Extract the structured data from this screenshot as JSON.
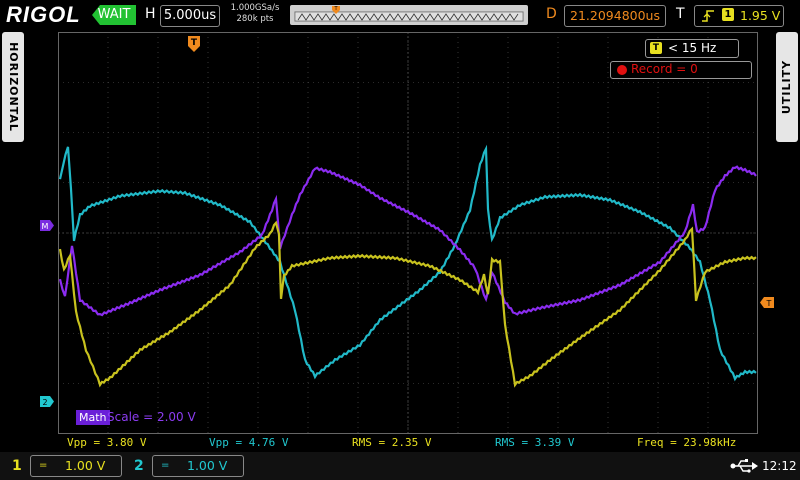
{
  "brand": "RIGOL",
  "status": "WAIT",
  "horizontal": {
    "label": "H",
    "timebase": "5.000us"
  },
  "sample": {
    "rate": "1.000GSa/s",
    "points": "280k pts"
  },
  "delay": {
    "label": "D",
    "value": "21.2094800us"
  },
  "trigger": {
    "label": "T",
    "edge_icon": "rising-edge-icon",
    "channel": "1",
    "level": "1.95 V"
  },
  "side_tabs": {
    "left": "HORIZONTAL",
    "right": "UTILITY"
  },
  "freq_counter": {
    "channel": "T",
    "value": "< 15 Hz"
  },
  "record": {
    "text": "Record = 0"
  },
  "markers": {
    "trigger_pos": "T",
    "math": "M",
    "ch2": "2",
    "trig_level": "T"
  },
  "math_label": {
    "tag": "Math",
    "scale": "Scale = 2.00 V"
  },
  "measurements": [
    {
      "text": "Vpp = 3.80 V",
      "color": "#e8e020"
    },
    {
      "text": "Vpp = 4.76 V",
      "color": "#21c8d0"
    },
    {
      "text": "RMS = 2.35 V",
      "color": "#e8e020"
    },
    {
      "text": "RMS = 3.39 V",
      "color": "#21c8d0"
    },
    {
      "text": "Freq = 23.98kHz",
      "color": "#e8e020"
    }
  ],
  "channels": [
    {
      "num": "1",
      "coupling": "=",
      "scale": "1.00 V",
      "color": "#e8e020"
    },
    {
      "num": "2",
      "coupling": "=",
      "scale": "1.00 V",
      "color": "#21c8d0"
    }
  ],
  "clock": "12:12",
  "colors": {
    "ch1": "#c8c21e",
    "ch2": "#21b9c8",
    "math": "#8b2cf0",
    "trigger": "#f08a1e"
  }
}
